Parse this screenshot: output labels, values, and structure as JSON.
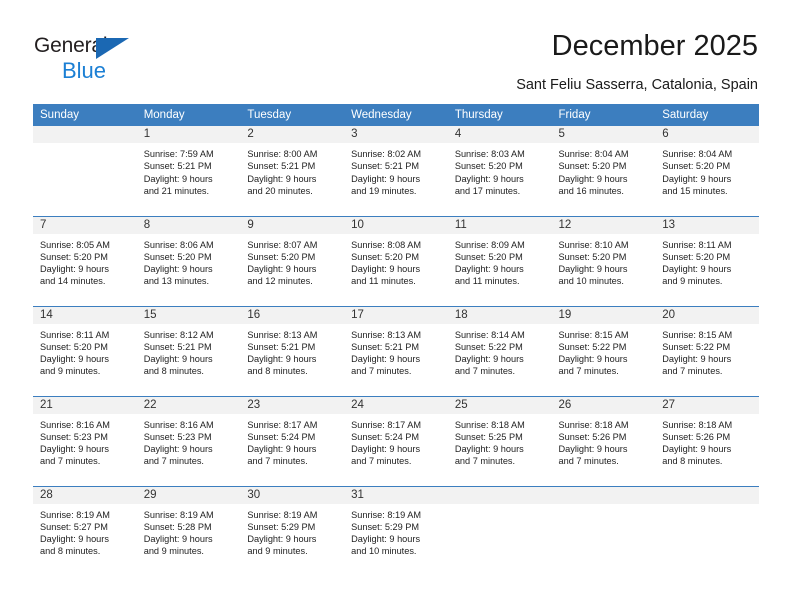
{
  "brand": {
    "word1": "General",
    "word2": "Blue",
    "triangle_color": "#1b68b3",
    "blue_text_color": "#1b7fd4"
  },
  "header": {
    "title": "December 2025",
    "subtitle": "Sant Feliu Sasserra, Catalonia, Spain"
  },
  "calendar": {
    "header_bg": "#3c7ebf",
    "daynum_bg": "#f2f2f2",
    "weekdays": [
      "Sunday",
      "Monday",
      "Tuesday",
      "Wednesday",
      "Thursday",
      "Friday",
      "Saturday"
    ],
    "weeks": [
      [
        {
          "day": "",
          "blank": true,
          "sunrise": "",
          "sunset": "",
          "daylight_line1": "",
          "daylight_line2": ""
        },
        {
          "day": "1",
          "blank": false,
          "sunrise": "Sunrise: 7:59 AM",
          "sunset": "Sunset: 5:21 PM",
          "daylight_line1": "Daylight: 9 hours",
          "daylight_line2": "and 21 minutes."
        },
        {
          "day": "2",
          "blank": false,
          "sunrise": "Sunrise: 8:00 AM",
          "sunset": "Sunset: 5:21 PM",
          "daylight_line1": "Daylight: 9 hours",
          "daylight_line2": "and 20 minutes."
        },
        {
          "day": "3",
          "blank": false,
          "sunrise": "Sunrise: 8:02 AM",
          "sunset": "Sunset: 5:21 PM",
          "daylight_line1": "Daylight: 9 hours",
          "daylight_line2": "and 19 minutes."
        },
        {
          "day": "4",
          "blank": false,
          "sunrise": "Sunrise: 8:03 AM",
          "sunset": "Sunset: 5:20 PM",
          "daylight_line1": "Daylight: 9 hours",
          "daylight_line2": "and 17 minutes."
        },
        {
          "day": "5",
          "blank": false,
          "sunrise": "Sunrise: 8:04 AM",
          "sunset": "Sunset: 5:20 PM",
          "daylight_line1": "Daylight: 9 hours",
          "daylight_line2": "and 16 minutes."
        },
        {
          "day": "6",
          "blank": false,
          "sunrise": "Sunrise: 8:04 AM",
          "sunset": "Sunset: 5:20 PM",
          "daylight_line1": "Daylight: 9 hours",
          "daylight_line2": "and 15 minutes."
        }
      ],
      [
        {
          "day": "7",
          "blank": false,
          "sunrise": "Sunrise: 8:05 AM",
          "sunset": "Sunset: 5:20 PM",
          "daylight_line1": "Daylight: 9 hours",
          "daylight_line2": "and 14 minutes."
        },
        {
          "day": "8",
          "blank": false,
          "sunrise": "Sunrise: 8:06 AM",
          "sunset": "Sunset: 5:20 PM",
          "daylight_line1": "Daylight: 9 hours",
          "daylight_line2": "and 13 minutes."
        },
        {
          "day": "9",
          "blank": false,
          "sunrise": "Sunrise: 8:07 AM",
          "sunset": "Sunset: 5:20 PM",
          "daylight_line1": "Daylight: 9 hours",
          "daylight_line2": "and 12 minutes."
        },
        {
          "day": "10",
          "blank": false,
          "sunrise": "Sunrise: 8:08 AM",
          "sunset": "Sunset: 5:20 PM",
          "daylight_line1": "Daylight: 9 hours",
          "daylight_line2": "and 11 minutes."
        },
        {
          "day": "11",
          "blank": false,
          "sunrise": "Sunrise: 8:09 AM",
          "sunset": "Sunset: 5:20 PM",
          "daylight_line1": "Daylight: 9 hours",
          "daylight_line2": "and 11 minutes."
        },
        {
          "day": "12",
          "blank": false,
          "sunrise": "Sunrise: 8:10 AM",
          "sunset": "Sunset: 5:20 PM",
          "daylight_line1": "Daylight: 9 hours",
          "daylight_line2": "and 10 minutes."
        },
        {
          "day": "13",
          "blank": false,
          "sunrise": "Sunrise: 8:11 AM",
          "sunset": "Sunset: 5:20 PM",
          "daylight_line1": "Daylight: 9 hours",
          "daylight_line2": "and 9 minutes."
        }
      ],
      [
        {
          "day": "14",
          "blank": false,
          "sunrise": "Sunrise: 8:11 AM",
          "sunset": "Sunset: 5:20 PM",
          "daylight_line1": "Daylight: 9 hours",
          "daylight_line2": "and 9 minutes."
        },
        {
          "day": "15",
          "blank": false,
          "sunrise": "Sunrise: 8:12 AM",
          "sunset": "Sunset: 5:21 PM",
          "daylight_line1": "Daylight: 9 hours",
          "daylight_line2": "and 8 minutes."
        },
        {
          "day": "16",
          "blank": false,
          "sunrise": "Sunrise: 8:13 AM",
          "sunset": "Sunset: 5:21 PM",
          "daylight_line1": "Daylight: 9 hours",
          "daylight_line2": "and 8 minutes."
        },
        {
          "day": "17",
          "blank": false,
          "sunrise": "Sunrise: 8:13 AM",
          "sunset": "Sunset: 5:21 PM",
          "daylight_line1": "Daylight: 9 hours",
          "daylight_line2": "and 7 minutes."
        },
        {
          "day": "18",
          "blank": false,
          "sunrise": "Sunrise: 8:14 AM",
          "sunset": "Sunset: 5:22 PM",
          "daylight_line1": "Daylight: 9 hours",
          "daylight_line2": "and 7 minutes."
        },
        {
          "day": "19",
          "blank": false,
          "sunrise": "Sunrise: 8:15 AM",
          "sunset": "Sunset: 5:22 PM",
          "daylight_line1": "Daylight: 9 hours",
          "daylight_line2": "and 7 minutes."
        },
        {
          "day": "20",
          "blank": false,
          "sunrise": "Sunrise: 8:15 AM",
          "sunset": "Sunset: 5:22 PM",
          "daylight_line1": "Daylight: 9 hours",
          "daylight_line2": "and 7 minutes."
        }
      ],
      [
        {
          "day": "21",
          "blank": false,
          "sunrise": "Sunrise: 8:16 AM",
          "sunset": "Sunset: 5:23 PM",
          "daylight_line1": "Daylight: 9 hours",
          "daylight_line2": "and 7 minutes."
        },
        {
          "day": "22",
          "blank": false,
          "sunrise": "Sunrise: 8:16 AM",
          "sunset": "Sunset: 5:23 PM",
          "daylight_line1": "Daylight: 9 hours",
          "daylight_line2": "and 7 minutes."
        },
        {
          "day": "23",
          "blank": false,
          "sunrise": "Sunrise: 8:17 AM",
          "sunset": "Sunset: 5:24 PM",
          "daylight_line1": "Daylight: 9 hours",
          "daylight_line2": "and 7 minutes."
        },
        {
          "day": "24",
          "blank": false,
          "sunrise": "Sunrise: 8:17 AM",
          "sunset": "Sunset: 5:24 PM",
          "daylight_line1": "Daylight: 9 hours",
          "daylight_line2": "and 7 minutes."
        },
        {
          "day": "25",
          "blank": false,
          "sunrise": "Sunrise: 8:18 AM",
          "sunset": "Sunset: 5:25 PM",
          "daylight_line1": "Daylight: 9 hours",
          "daylight_line2": "and 7 minutes."
        },
        {
          "day": "26",
          "blank": false,
          "sunrise": "Sunrise: 8:18 AM",
          "sunset": "Sunset: 5:26 PM",
          "daylight_line1": "Daylight: 9 hours",
          "daylight_line2": "and 7 minutes."
        },
        {
          "day": "27",
          "blank": false,
          "sunrise": "Sunrise: 8:18 AM",
          "sunset": "Sunset: 5:26 PM",
          "daylight_line1": "Daylight: 9 hours",
          "daylight_line2": "and 8 minutes."
        }
      ],
      [
        {
          "day": "28",
          "blank": false,
          "sunrise": "Sunrise: 8:19 AM",
          "sunset": "Sunset: 5:27 PM",
          "daylight_line1": "Daylight: 9 hours",
          "daylight_line2": "and 8 minutes."
        },
        {
          "day": "29",
          "blank": false,
          "sunrise": "Sunrise: 8:19 AM",
          "sunset": "Sunset: 5:28 PM",
          "daylight_line1": "Daylight: 9 hours",
          "daylight_line2": "and 9 minutes."
        },
        {
          "day": "30",
          "blank": false,
          "sunrise": "Sunrise: 8:19 AM",
          "sunset": "Sunset: 5:29 PM",
          "daylight_line1": "Daylight: 9 hours",
          "daylight_line2": "and 9 minutes."
        },
        {
          "day": "31",
          "blank": false,
          "sunrise": "Sunrise: 8:19 AM",
          "sunset": "Sunset: 5:29 PM",
          "daylight_line1": "Daylight: 9 hours",
          "daylight_line2": "and 10 minutes."
        },
        {
          "day": "",
          "blank": true,
          "sunrise": "",
          "sunset": "",
          "daylight_line1": "",
          "daylight_line2": ""
        },
        {
          "day": "",
          "blank": true,
          "sunrise": "",
          "sunset": "",
          "daylight_line1": "",
          "daylight_line2": ""
        },
        {
          "day": "",
          "blank": true,
          "sunrise": "",
          "sunset": "",
          "daylight_line1": "",
          "daylight_line2": ""
        }
      ]
    ]
  }
}
